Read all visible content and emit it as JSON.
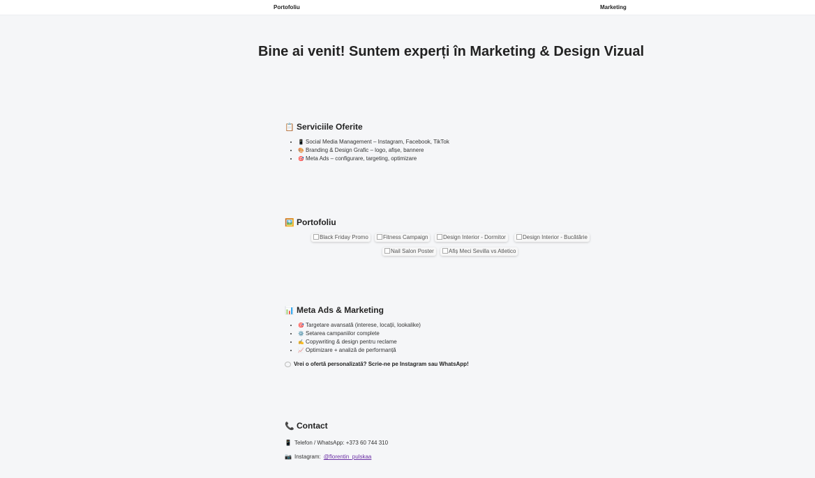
{
  "nav": {
    "portfolio": "Portofoliu",
    "marketing": "Marketing"
  },
  "hero": {
    "title": "Bine ai venit! Suntem experți în Marketing & Design Vizual"
  },
  "services": {
    "icon": "📋",
    "title": "Serviciile Oferite",
    "items": [
      {
        "icon": "📱",
        "text": "Social Media Management – Instagram, Facebook, TikTok"
      },
      {
        "icon": "🎨",
        "text": "Branding & Design Grafic – logo, afișe, bannere"
      },
      {
        "icon": "🎯",
        "text": "Meta Ads – configurare, targeting, optimizare"
      }
    ]
  },
  "portfolio": {
    "icon": "🖼️",
    "title": "Portofoliu",
    "images": [
      {
        "alt": "Black Friday Promo"
      },
      {
        "alt": "Fitness Campaign"
      },
      {
        "alt": "Design Interior - Dormitor"
      },
      {
        "alt": "Design Interior - Bucătărie"
      },
      {
        "alt": "Nail Salon Poster"
      },
      {
        "alt": "Afiș Meci Sevilla vs Atletico"
      }
    ]
  },
  "meta": {
    "icon": "📊",
    "title": "Meta Ads & Marketing",
    "items": [
      {
        "icon": "🎯",
        "text": "Targetare avansată (interese, locații, lookalike)"
      },
      {
        "icon": "⚙️",
        "text": "Setarea campaniilor complete"
      },
      {
        "icon": "✍️",
        "text": "Copywriting & design pentru reclame"
      },
      {
        "icon": "📈",
        "text": "Optimizare + analiză de performanță"
      }
    ],
    "cta_icon": "💬",
    "cta": "Vrei o ofertă personalizată? Scrie-ne pe Instagram sau WhatsApp!"
  },
  "contact": {
    "icon": "📞",
    "title": "Contact",
    "phone_icon": "📱",
    "phone_label": "Telefon / WhatsApp: +373 60 744 310",
    "instagram_icon": "📷",
    "instagram_label": "Instagram:",
    "instagram_handle": "@florentin_pulskaa"
  }
}
